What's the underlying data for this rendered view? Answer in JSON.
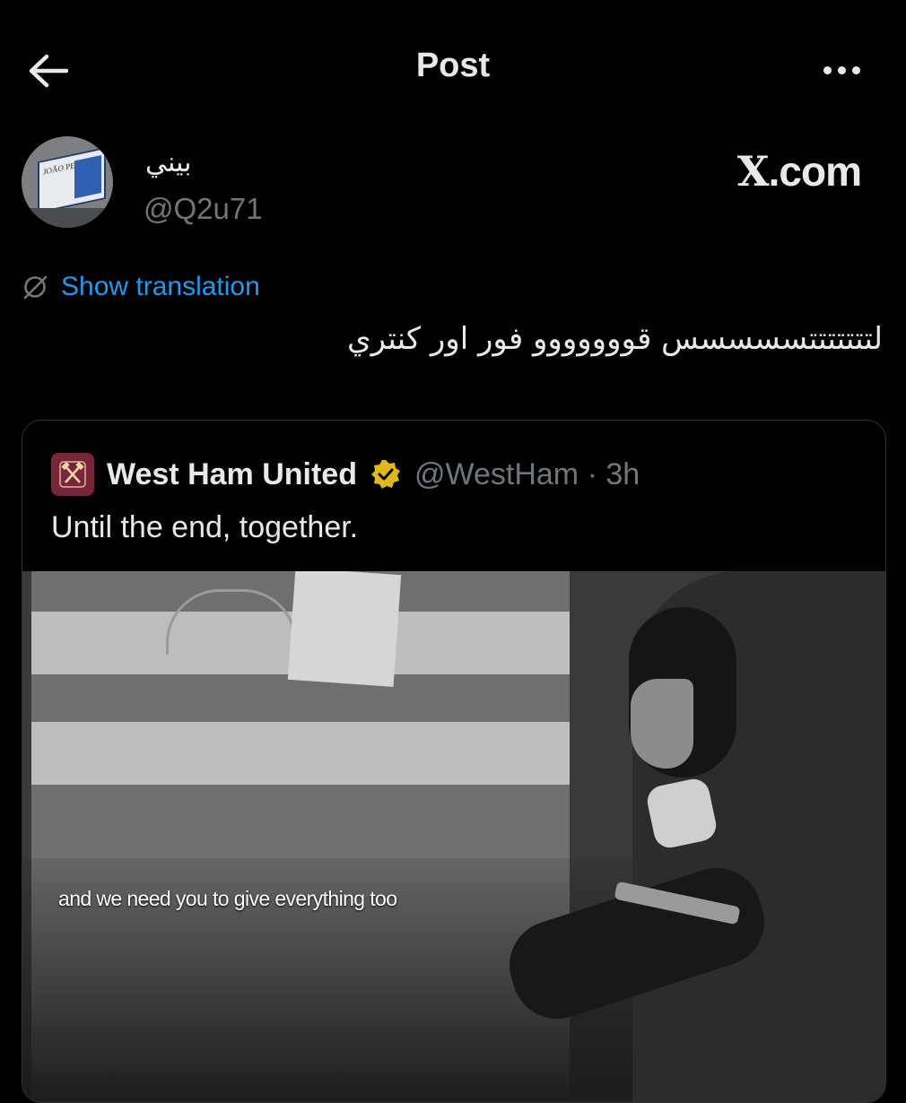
{
  "header": {
    "title": "Post",
    "back_icon": "arrow-left-icon",
    "more_icon": "more-horizontal-icon"
  },
  "author": {
    "display_name": "بيني",
    "handle": "@Q2u71",
    "avatar_text": "JOÃO PEDRO"
  },
  "watermark": {
    "text": ".com",
    "logo": "X"
  },
  "translation": {
    "label": "Show translation",
    "icon": "translate-globe-icon"
  },
  "post": {
    "text": "لتتتتتتتسسسسس قووووووو فور اور كنتري"
  },
  "quoted": {
    "name": "West Ham United",
    "handle": "@WestHam",
    "separator": "·",
    "time": "3h",
    "text": "Until the end, together.",
    "verified_color": "#e2b719",
    "crest_color": "#7a263a",
    "media_caption": "and we need you to give everything too"
  },
  "colors": {
    "background": "#000000",
    "text": "#e7e9ea",
    "secondary": "#71767b",
    "link": "#1d9bf0",
    "border": "#2f3336"
  }
}
